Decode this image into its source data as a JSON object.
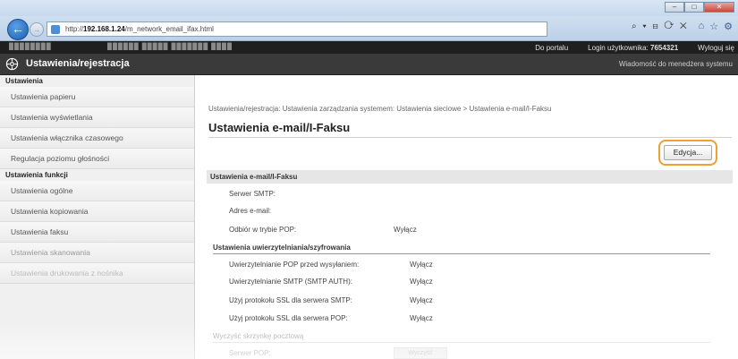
{
  "browser": {
    "url_prefix": "http://",
    "url_host": "192.168.1.24",
    "url_path": "/m_network_email_ifax.html",
    "addr_tools": "⌕ ▾ ⊟ ⟳ ✕",
    "nav_icons": [
      "home-icon",
      "star-icon",
      "gear-icon"
    ],
    "window_controls": [
      "–",
      "□",
      "✕"
    ]
  },
  "topbar": {
    "portal_link": "Do portalu",
    "login_label": "Login użytkownika:",
    "login_value": "7654321",
    "logout_link": "Wyloguj się"
  },
  "header": {
    "title": "Ustawienia/rejestracja",
    "admin_message": "Wiadomość do menedżera systemu"
  },
  "sidebar": {
    "section1": "Ustawienia",
    "items1": [
      "Ustawienia papieru",
      "Ustawienia wyświetlania",
      "Ustawienia włącznika czasowego",
      "Regulacja poziomu głośności"
    ],
    "section2": "Ustawienia funkcji",
    "items2": [
      "Ustawienia ogólne",
      "Ustawienia kopiowania",
      "Ustawienia faksu",
      "Ustawienia skanowania",
      "Ustawienia drukowania z nośnika"
    ]
  },
  "main": {
    "breadcrumb": "Ustawienia/rejestracja: Ustawienia zarządzania systemem: Ustawienia sieciowe > Ustawienia e-mail/I-Faksu",
    "title": "Ustawienia e-mail/I-Faksu",
    "edit_button": "Edycja...",
    "section_title": "Ustawienia e-mail/I-Faksu",
    "rows": {
      "smtp_server": "Serwer SMTP:",
      "email_address": "Adres e-mail:",
      "pop_receive": "Odbiór w trybie POP:",
      "pop_receive_val": "Wyłącz"
    },
    "auth_title": "Ustawienia uwierzytelniania/szyfrowania",
    "auth_rows": [
      {
        "label": "Uwierzytelnianie POP przed wysyłaniem:",
        "value": "Wyłącz"
      },
      {
        "label": "Uwierzytelnianie SMTP (SMTP AUTH):",
        "value": "Wyłącz"
      },
      {
        "label": "Użyj protokołu SSL dla serwera SMTP:",
        "value": "Wyłącz"
      },
      {
        "label": "Użyj protokołu SSL dla serwera POP:",
        "value": "Wyłącz"
      }
    ],
    "clear_mailbox": "Wyczyść skrzynkę pocztową",
    "pop_server": "Serwer POP:",
    "pop_button": "Wyczyść"
  }
}
